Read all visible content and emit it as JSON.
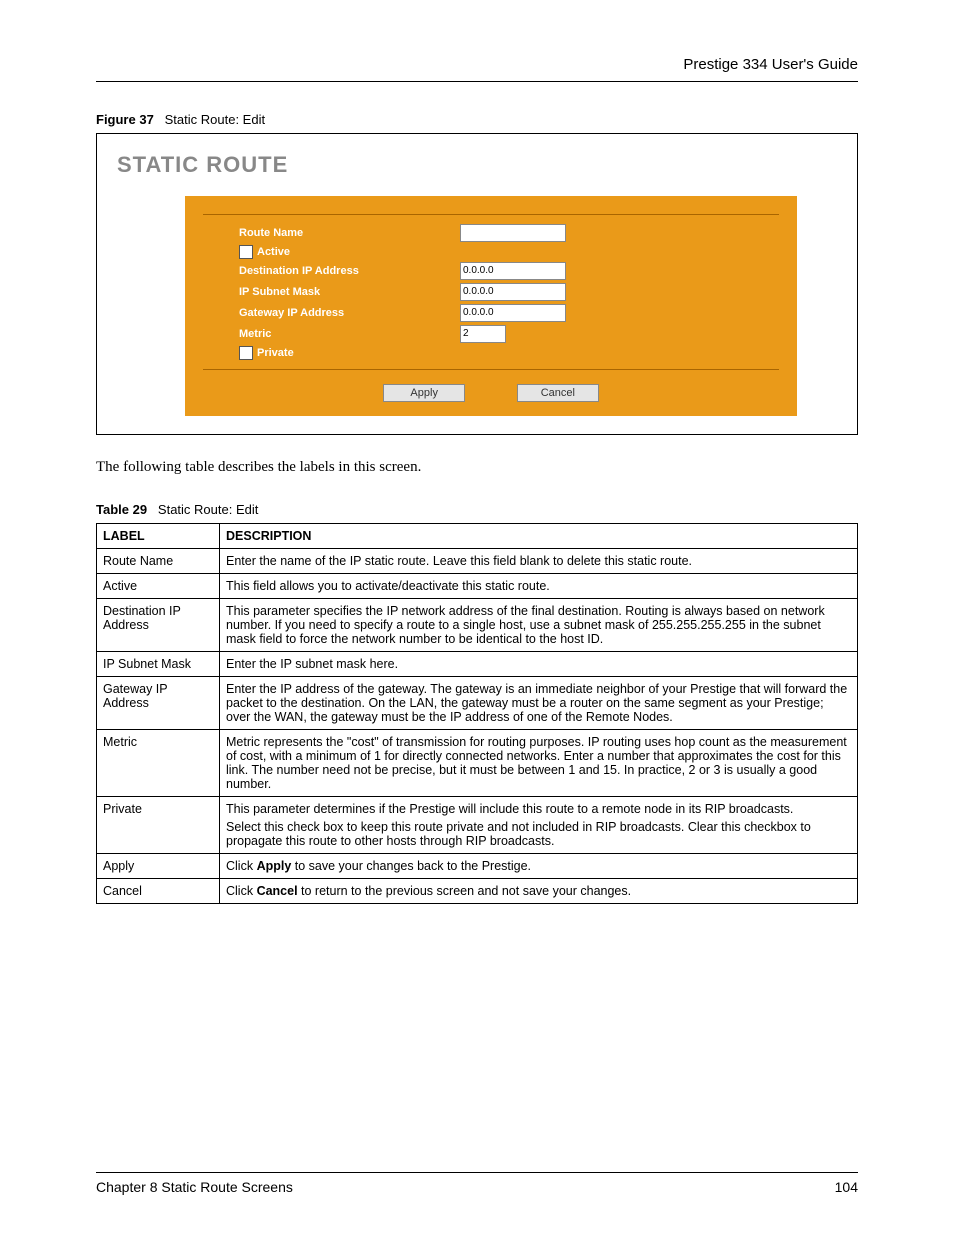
{
  "header": {
    "title": "Prestige 334 User's Guide"
  },
  "figure": {
    "label": "Figure 37",
    "title": "Static Route: Edit",
    "panel_title": "STATIC ROUTE",
    "form": {
      "route_name_label": "Route Name",
      "route_name_value": "",
      "active_label": "Active",
      "dest_ip_label": "Destination IP Address",
      "dest_ip_value": "0.0.0.0",
      "subnet_label": "IP Subnet Mask",
      "subnet_value": "0.0.0.0",
      "gateway_label": "Gateway IP Address",
      "gateway_value": "0.0.0.0",
      "metric_label": "Metric",
      "metric_value": "2",
      "private_label": "Private",
      "apply_btn": "Apply",
      "cancel_btn": "Cancel"
    }
  },
  "intro_text": "The following table describes the labels in this screen.",
  "table": {
    "label": "Table 29",
    "title": "Static Route: Edit",
    "head_label": "LABEL",
    "head_desc": "DESCRIPTION",
    "rows": [
      {
        "label": "Route Name",
        "desc": "Enter the name of the IP static route. Leave this field blank to delete this static route."
      },
      {
        "label": "Active",
        "desc": "This field allows you to activate/deactivate this static route."
      },
      {
        "label": "Destination IP Address",
        "desc": "This parameter specifies the IP network address of the final destination.  Routing is always based on network number. If you need to specify a route to a single host, use a subnet mask of 255.255.255.255 in the subnet mask field to force the network number to be identical to the host ID."
      },
      {
        "label": "IP Subnet Mask",
        "desc": "Enter the IP subnet mask here."
      },
      {
        "label": "Gateway IP Address",
        "desc": "Enter the IP address of the gateway. The gateway is an immediate neighbor of your Prestige that will forward the packet to the destination. On the LAN, the gateway must be a router on the same segment as your Prestige; over the WAN, the gateway must be the IP address of one of the Remote Nodes."
      },
      {
        "label": "Metric",
        "desc": "Metric represents the \"cost\" of transmission for routing purposes. IP routing uses hop count as the measurement of cost, with a minimum of 1 for directly connected networks. Enter a number that approximates the cost for this link. The number need not be precise, but it must be between 1 and 15. In practice, 2 or 3 is usually a good number."
      },
      {
        "label": "Private",
        "desc": "This parameter determines if the Prestige will include this route to a remote node in its RIP broadcasts.\nSelect this check box to keep this route private and not included in RIP broadcasts. Clear this checkbox to propagate this route to other hosts through RIP broadcasts."
      },
      {
        "label": "Apply",
        "desc_prefix": "Click ",
        "desc_bold": "Apply",
        "desc_suffix": " to save your changes back to the Prestige."
      },
      {
        "label": "Cancel",
        "desc_prefix": "Click ",
        "desc_bold": "Cancel",
        "desc_suffix": " to return to the previous screen and not save your changes."
      }
    ]
  },
  "footer": {
    "left": "Chapter 8 Static Route Screens",
    "right": "104"
  }
}
